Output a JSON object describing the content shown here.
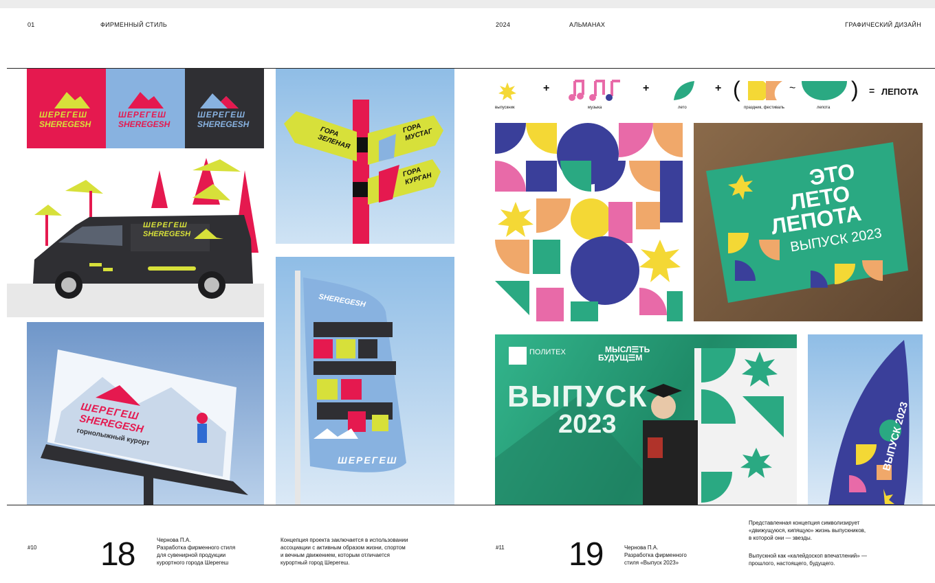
{
  "header": {
    "left_num": "01",
    "left_section": "ФИРМЕННЫЙ СТИЛЬ",
    "year": "2024",
    "almanac": "АЛЬМАНАХ",
    "right_section": "ГРАФИЧЕСКИЙ ДИЗАЙН"
  },
  "left_page": {
    "logo_ru": "ШЕРЕГЕШ",
    "logo_en": "SHEREGESH",
    "van_ru": "ШЕРЕГЕШ",
    "van_en": "SHEREGESH",
    "sign1": "ГОРА ЗЕЛЕНАЯ",
    "sign2": "ГОРА МУСТАГ",
    "sign3": "ГОРА КУРГАН",
    "billboard_ru": "ШЕРЕГЕШ",
    "billboard_en": "SHEREGESH",
    "billboard_sub": "горнолыжный курорт",
    "flag_top": "SHEREGESH",
    "flag_bottom": "ШЕРЕГЕШ"
  },
  "right_page": {
    "formula": {
      "plus": "+",
      "tilde": "~",
      "paren_open": "(",
      "paren_close": ")",
      "equals": "=",
      "l1": "выпускник",
      "l2": "музыка",
      "l3": "лето",
      "l4": "праздник, фестиваль",
      "l5": "лепота",
      "result": "ЛЕПОТА"
    },
    "card_l1": "ЭТО",
    "card_l2": "ЛЕТО",
    "card_l3": "ЛЕПОТА",
    "card_l4": "ВЫПУСК 2023",
    "banner_logo": "ПОЛИТЕХ",
    "banner_slogan_1": "МЫСЛ☰ТЬ",
    "banner_slogan_2": "БУДУЩ☰М",
    "banner_title": "ВЫПУСК",
    "banner_year": "2023",
    "flag_text": "ВЫПУСК 2023"
  },
  "footer": {
    "left_id": "#10",
    "left_page": "18",
    "left_author": "Чернова П.А.",
    "left_work_1": "Разработка фирменного стиля",
    "left_work_2": "для сувенирной продукции",
    "left_work_3": "курортного города Шерегеш",
    "left_desc_1": "Концепция проекта заключается в использовании",
    "left_desc_2": "ассоциации с активным образом жизни, спортом",
    "left_desc_3": "и вечным движением, которым отличается",
    "left_desc_4": "курортный город Шерегеш.",
    "right_id": "#11",
    "right_page": "19",
    "right_author": "Чернова П.А.",
    "right_work_1": "Разработка фирменного",
    "right_work_2": "стиля «Выпуск 2023»",
    "right_desc_1": "Представленная концепция символизирует",
    "right_desc_2": "«движущуюся, кипящую» жизнь выпускников,",
    "right_desc_3": "в которой они — звезды.",
    "right_desc_4": "Выпускной как «калейдоскоп впечатлений» —",
    "right_desc_5": "прошлого, настоящего, будущего."
  },
  "colors": {
    "brand_pink": "#e5194f",
    "brand_lime": "#d7e03a",
    "sky_blue": "#a9c9e8",
    "charcoal": "#2f2f33",
    "teal": "#2aa982",
    "navy": "#3a3f9a",
    "yellow": "#f4d835",
    "orange": "#f0a86a",
    "magenta": "#e86aa8"
  }
}
